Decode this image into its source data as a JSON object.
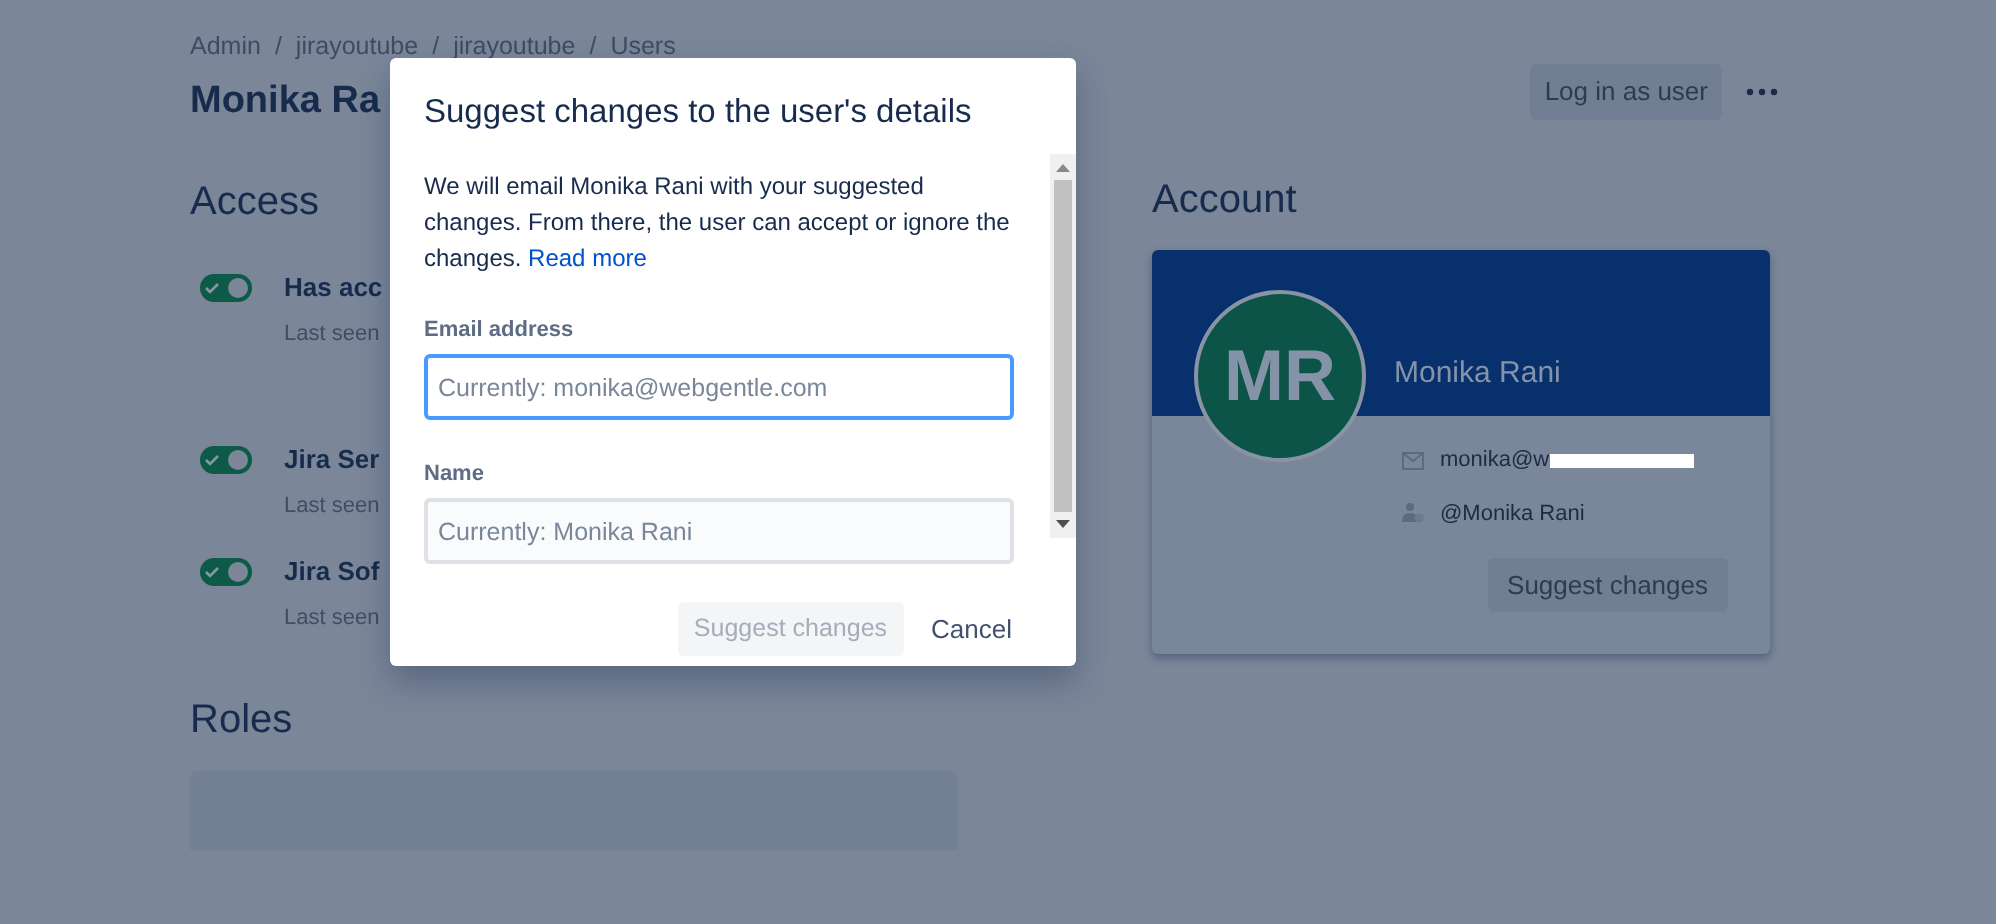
{
  "breadcrumbs": [
    {
      "label": "Admin"
    },
    {
      "separator": "/",
      "label": "jirayoutube"
    },
    {
      "separator": "/",
      "label": "jirayoutube"
    },
    {
      "separator": "/",
      "label": "Users"
    }
  ],
  "page_title": "Monika Ra",
  "header_actions": {
    "login_button": "Log in as user"
  },
  "access": {
    "heading": "Access",
    "items": [
      {
        "title": "Has acc",
        "subtitle": "Last seen",
        "on": true
      },
      {
        "title": "Jira Ser",
        "subtitle": "Last seen",
        "on": true
      },
      {
        "title": "Jira Sof",
        "subtitle": "Last seen",
        "on": true
      }
    ]
  },
  "account": {
    "heading": "Account",
    "initials": "MR",
    "name": "Monika Rani",
    "email": "monika@w",
    "username": "@Monika Rani",
    "button": "Suggest changes"
  },
  "roles": {
    "heading": "Roles"
  },
  "dialog": {
    "title": "Suggest changes to the user's details",
    "body": "We will email Monika Rani with your suggested changes. From there, the user can accept or ignore the changes.",
    "link": "Read more",
    "fields": [
      {
        "label": "Email address",
        "placeholder": "Currently: monika@webgentle.com",
        "focused": true
      },
      {
        "label": "Name",
        "placeholder": "Currently: Monika Rani",
        "focused": false
      }
    ],
    "submit": {
      "label": "Suggest changes",
      "disabled": true
    },
    "cancel": "Cancel"
  }
}
